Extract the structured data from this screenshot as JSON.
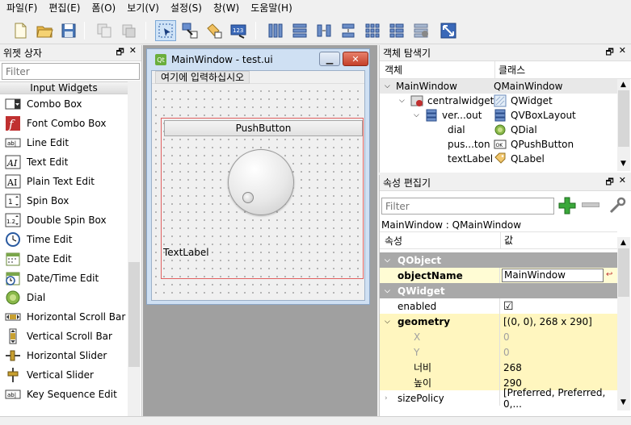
{
  "menubar": [
    "파일(F)",
    "편집(E)",
    "폼(O)",
    "보기(V)",
    "설정(S)",
    "창(W)",
    "도움말(H)"
  ],
  "widget_box": {
    "title": "위젯 상자",
    "filter_placeholder": "Filter",
    "category": "Input Widgets",
    "items": [
      "Combo Box",
      "Font Combo Box",
      "Line Edit",
      "Text Edit",
      "Plain Text Edit",
      "Spin Box",
      "Double Spin Box",
      "Time Edit",
      "Date Edit",
      "Date/Time Edit",
      "Dial",
      "Horizontal Scroll Bar",
      "Vertical Scroll Bar",
      "Horizontal Slider",
      "Vertical Slider",
      "Key Sequence Edit"
    ]
  },
  "form": {
    "title": "MainWindow - test.ui",
    "menu_placeholder": "여기에 입력하십시오",
    "push_button": "PushButton",
    "text_label": "TextLabel"
  },
  "object_inspector": {
    "title": "객체 탐색기",
    "col_object": "객체",
    "col_class": "클래스",
    "rows": [
      {
        "name": "MainWindow",
        "class": "QMainWindow",
        "indent": 0,
        "arrow": "v"
      },
      {
        "name": "centralwidget",
        "class": "QWidget",
        "indent": 1,
        "arrow": "v"
      },
      {
        "name": "ver...out",
        "class": "QVBoxLayout",
        "indent": 2,
        "arrow": "v"
      },
      {
        "name": "dial",
        "class": "QDial",
        "indent": 3,
        "arrow": ""
      },
      {
        "name": "pus...ton",
        "class": "QPushButton",
        "indent": 3,
        "arrow": ""
      },
      {
        "name": "textLabel",
        "class": "QLabel",
        "indent": 3,
        "arrow": ""
      }
    ]
  },
  "property_editor": {
    "title": "속성 편집기",
    "filter_placeholder": "Filter",
    "class_line": "MainWindow : QMainWindow",
    "col_property": "속성",
    "col_value": "값",
    "rows": [
      {
        "type": "cat",
        "name": "QObject",
        "value": ""
      },
      {
        "type": "y",
        "name": "objectName",
        "value": "MainWindow"
      },
      {
        "type": "cat",
        "name": "QWidget",
        "value": ""
      },
      {
        "type": "w",
        "name": "enabled",
        "value": "☑"
      },
      {
        "type": "y2",
        "name": "geometry",
        "value": "[(0, 0), 268 x 290]"
      },
      {
        "type": "sub",
        "name": "X",
        "value": "0"
      },
      {
        "type": "sub",
        "name": "Y",
        "value": "0"
      },
      {
        "type": "sub2",
        "name": "너비",
        "value": "268"
      },
      {
        "type": "sub2",
        "name": "높이",
        "value": "290"
      },
      {
        "type": "w",
        "name": "sizePolicy",
        "value": "[Preferred, Preferred, 0,..."
      }
    ]
  }
}
